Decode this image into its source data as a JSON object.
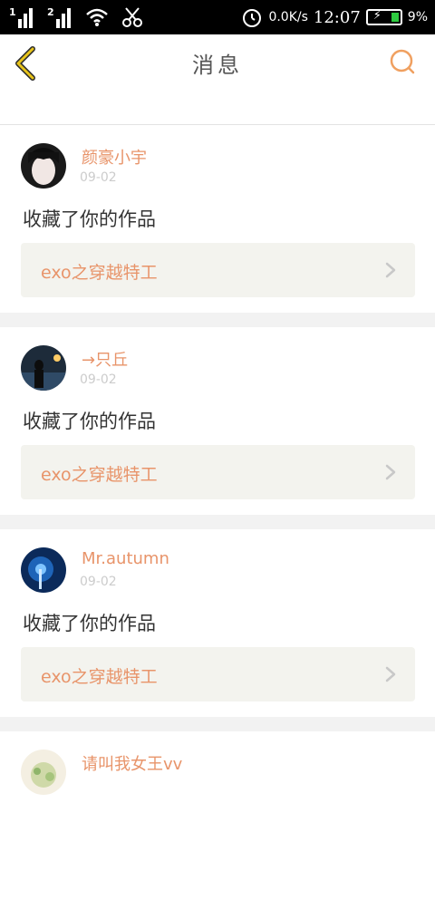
{
  "status_bar": {
    "sim1": "1",
    "sim2": "2",
    "net_speed": "0.0K/s",
    "time": "12:07",
    "battery": "9%"
  },
  "header": {
    "title": "消息"
  },
  "messages": [
    {
      "username": "颜豪小宇",
      "date": "09-02",
      "action": "收藏了你的作品",
      "work_title": "exo之穿越特工"
    },
    {
      "username": "→只丘",
      "date": "09-02",
      "action": "收藏了你的作品",
      "work_title": "exo之穿越特工"
    },
    {
      "username": "Mr.autumn",
      "date": "09-02",
      "action": "收藏了你的作品",
      "work_title": "exo之穿越特工"
    },
    {
      "username": "请叫我女王vv"
    }
  ],
  "colors": {
    "accent": "#e8946a",
    "back_icon": "#e8c41a",
    "status_bar_bg": "#000000",
    "card_bg": "#ffffff",
    "link_bg": "#f3f3ee"
  },
  "icons": {
    "back": "chevron-left-icon",
    "search": "search-icon",
    "wifi": "wifi-icon",
    "alarm": "alarm-icon",
    "link_arrow": "chevron-right-icon"
  }
}
